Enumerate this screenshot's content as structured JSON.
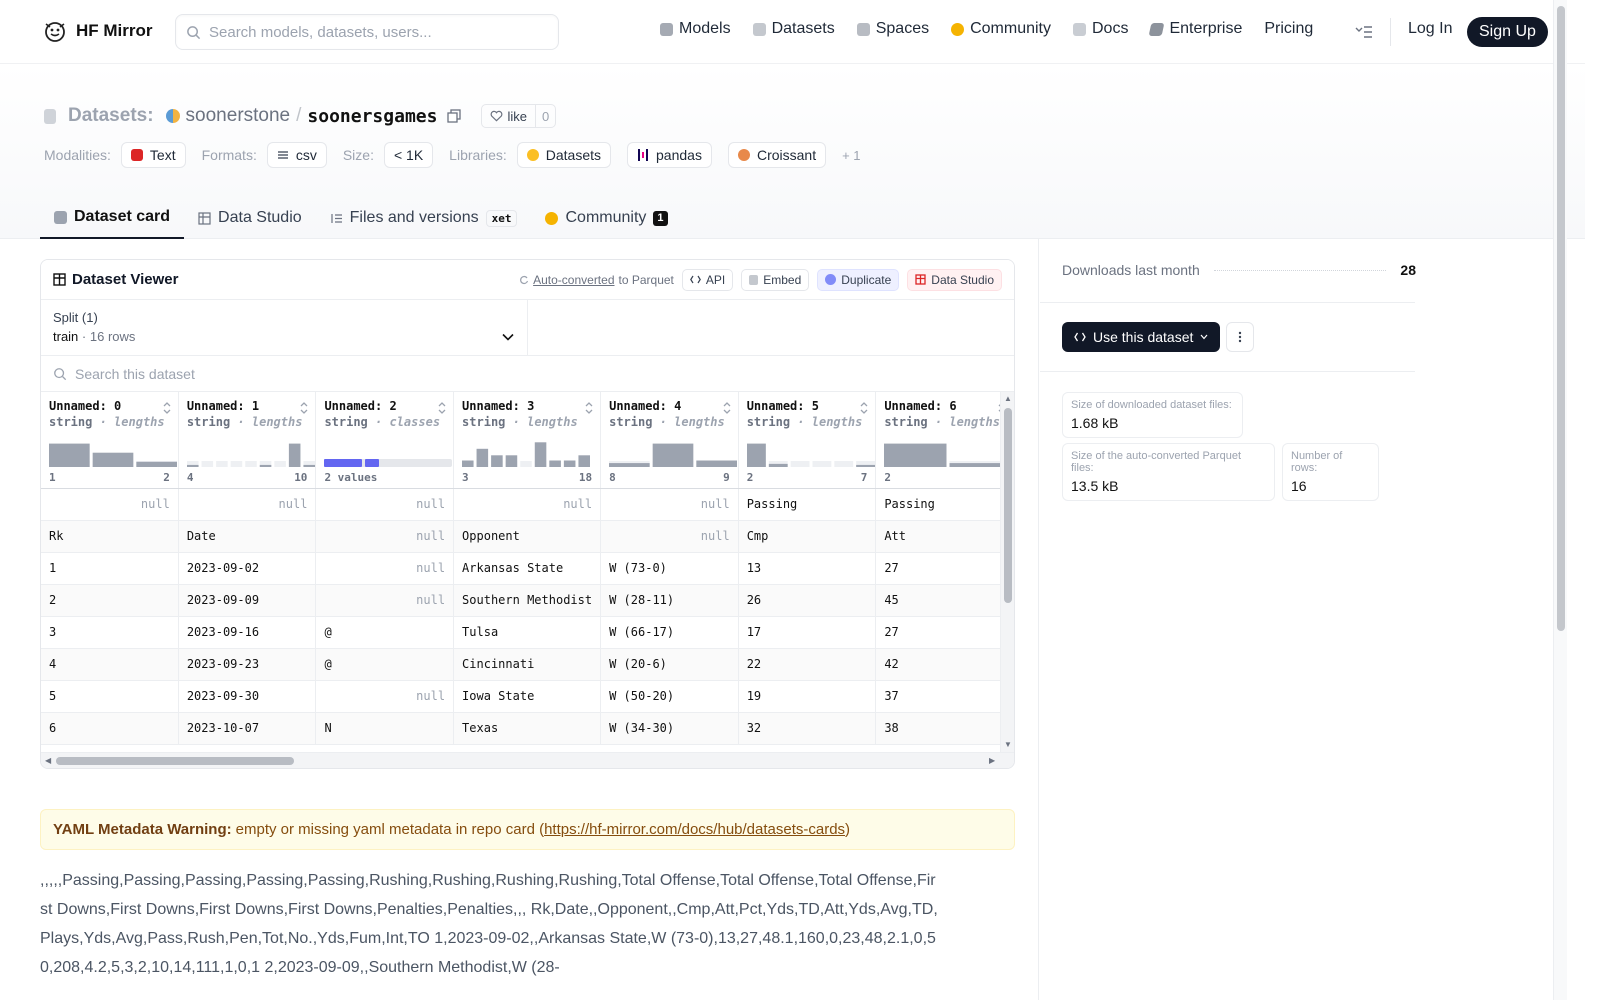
{
  "nav": {
    "brand": "HF Mirror",
    "search_placeholder": "Search models, datasets, users...",
    "links": [
      "Models",
      "Datasets",
      "Spaces",
      "Community",
      "Docs",
      "Enterprise",
      "Pricing"
    ],
    "login": "Log In",
    "signup": "Sign Up"
  },
  "repo": {
    "type_label": "Datasets:",
    "owner": "soonerstone",
    "slash": "/",
    "name": "soonersgames",
    "like_label": "like",
    "like_count": "0"
  },
  "tags": {
    "modalities_label": "Modalities:",
    "modality": "Text",
    "formats_label": "Formats:",
    "format": "csv",
    "size_label": "Size:",
    "size": "< 1K",
    "libraries_label": "Libraries:",
    "libraries": [
      "Datasets",
      "pandas",
      "Croissant"
    ],
    "more": "+ 1"
  },
  "tabs": {
    "card": "Dataset card",
    "studio": "Data Studio",
    "files": "Files and versions",
    "xet": "xet",
    "community": "Community",
    "community_count": "1"
  },
  "viewer": {
    "title": "Dataset Viewer",
    "auto_converted": "Auto-converted",
    "to_parquet": "to Parquet",
    "api": "API",
    "embed": "Embed",
    "duplicate": "Duplicate",
    "data_studio": "Data Studio",
    "split_label": "Split (1)",
    "split_name": "train",
    "split_rows": "16 rows",
    "search_placeholder": "Search this dataset",
    "columns": [
      {
        "name": "Unnamed: 0",
        "type": "string",
        "stat": "lengths",
        "min": "1",
        "max": "2",
        "hist": [
          0.9,
          0.55,
          0.2
        ]
      },
      {
        "name": "Unnamed: 1",
        "type": "string",
        "stat": "lengths",
        "min": "4",
        "max": "10",
        "hist": [
          0.08,
          0,
          0,
          0,
          0,
          0.08,
          0,
          0.9,
          0.08
        ]
      },
      {
        "name": "Unnamed: 2",
        "type": "string",
        "stat": "classes",
        "min": "2 values",
        "max": "",
        "hist": []
      },
      {
        "name": "Unnamed: 3",
        "type": "string",
        "stat": "lengths",
        "min": "3",
        "max": "18",
        "hist": [
          0.25,
          0.7,
          0.45,
          0.45,
          0,
          0.95,
          0.25,
          0.25,
          0.45
        ]
      },
      {
        "name": "Unnamed: 4",
        "type": "string",
        "stat": "lengths",
        "min": "8",
        "max": "9",
        "hist": [
          0.15,
          0.9,
          0.25
        ]
      },
      {
        "name": "Unnamed: 5",
        "type": "string",
        "stat": "lengths",
        "min": "2",
        "max": "7",
        "hist": [
          0.9,
          0.12,
          0,
          0,
          0,
          0.08
        ]
      },
      {
        "name": "Unnamed: 6",
        "type": "string",
        "stat": "lengths",
        "min": "2",
        "max": "",
        "hist": [
          0.9,
          0.15
        ]
      }
    ],
    "rows": [
      [
        "null",
        "null",
        "null",
        "null",
        "null",
        "Passing",
        "Passing"
      ],
      [
        "Rk",
        "Date",
        "null",
        "Opponent",
        "null",
        "Cmp",
        "Att"
      ],
      [
        "1",
        "2023-09-02",
        "null",
        "Arkansas State",
        "W (73-0)",
        "13",
        "27"
      ],
      [
        "2",
        "2023-09-09",
        "null",
        "Southern Methodist",
        "W (28-11)",
        "26",
        "45"
      ],
      [
        "3",
        "2023-09-16",
        "@",
        "Tulsa",
        "W (66-17)",
        "17",
        "27"
      ],
      [
        "4",
        "2023-09-23",
        "@",
        "Cincinnati",
        "W (20-6)",
        "22",
        "42"
      ],
      [
        "5",
        "2023-09-30",
        "null",
        "Iowa State",
        "W (50-20)",
        "19",
        "37"
      ],
      [
        "6",
        "2023-10-07",
        "N",
        "Texas",
        "W (34-30)",
        "32",
        "38"
      ]
    ]
  },
  "warning": {
    "title": "YAML Metadata Warning:",
    "text": "empty or missing yaml metadata in repo card (",
    "link": "https://hf-mirror.com/docs/hub/datasets-cards",
    "close": ")"
  },
  "body_text": ",,,,,Passing,Passing,Passing,Passing,Passing,Rushing,Rushing,Rushing,Rushing,Total Offense,Total Offense,Total Offense,First Downs,First Downs,First Downs,First Downs,Penalties,Penalties,,, Rk,Date,,Opponent,,Cmp,Att,Pct,Yds,TD,Att,Yds,Avg,TD,Plays,Yds,Avg,Pass,Rush,Pen,Tot,No.,Yds,Fum,Int,TO 1,2023-09-02,,Arkansas State,W (73-0),13,27,48.1,160,0,23,48,2.1,0,50,208,4.2,5,3,2,10,14,111,1,0,1 2,2023-09-09,,Southern Methodist,W (28-",
  "sidebar": {
    "downloads_label": "Downloads last month",
    "downloads": "28",
    "use_button": "Use this dataset",
    "stats": [
      {
        "label": "Size of downloaded dataset files:",
        "value": "1.68 kB"
      },
      {
        "label": "Size of the auto-converted Parquet files:",
        "value": "13.5 kB"
      },
      {
        "label": "Number of rows:",
        "value": "16"
      }
    ]
  },
  "colors": {
    "accent": "#111827",
    "warning_bg": "#fefce8",
    "hist_bar": "#9ca3af",
    "class_bar": "#6366f1"
  }
}
